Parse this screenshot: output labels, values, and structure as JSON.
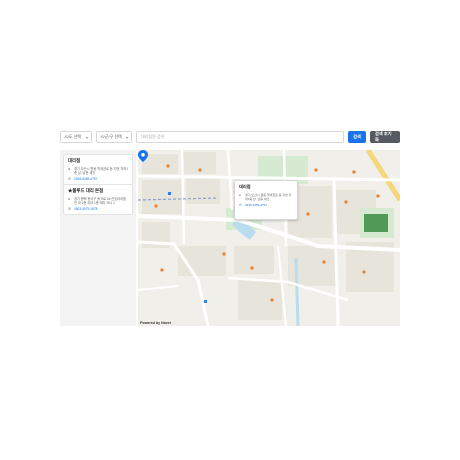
{
  "toolbar": {
    "province_select": "시/도 선택",
    "district_select": "시/군/구 선택",
    "search_placeholder": "대리점명 검색",
    "search_button": "검색",
    "reset_button": "검색 초기화"
  },
  "stores": [
    {
      "name": "대리점",
      "address": "경기 오산시 원동 역세권로 등 지번 지하1층 남, 남층 새인",
      "phone": "0345-6459-4767"
    },
    {
      "name": "★블루드 대리 본점",
      "address": "경기 평택 동삭구 동삭로 2a 산호대리점 전 대 2층 공대 1층 테라 코너 1",
      "phone": "0503-3579-1878"
    }
  ],
  "popup": {
    "name": "대리점",
    "address": "경기 오산시 원동 역세권로 등 지번 지하1층 남, 남층 새인",
    "phone": "0345-6459-4767"
  },
  "map": {
    "watermark": "Powered by Naver",
    "colors": {
      "block": "#e7e4dc",
      "road": "#ffffff",
      "park": "#d6ead1",
      "water": "#b9dcef",
      "highway": "#f5d77a",
      "rail": "#8aa0c8",
      "poi": "#e9822e",
      "marker": "#1a73e8"
    }
  }
}
